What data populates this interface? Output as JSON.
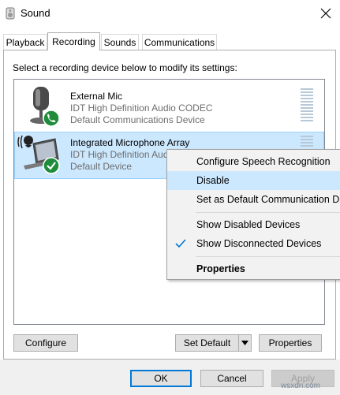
{
  "window": {
    "title": "Sound"
  },
  "tabs": [
    {
      "label": "Playback",
      "active": false
    },
    {
      "label": "Recording",
      "active": true
    },
    {
      "label": "Sounds",
      "active": false
    },
    {
      "label": "Communications",
      "active": false
    }
  ],
  "instruction": "Select a recording device below to modify its settings:",
  "devices": [
    {
      "name": "External Mic",
      "driver": "IDT High Definition Audio CODEC",
      "status": "Default Communications Device",
      "icon": "microphone-icon",
      "badge": "phone-badge-icon"
    },
    {
      "name": "Integrated Microphone Array",
      "driver": "IDT High Definition Audio",
      "status": "Default Device",
      "icon": "laptop-microphone-icon",
      "badge": "checkmark-badge-icon",
      "selected": true
    }
  ],
  "context_menu": {
    "items": [
      {
        "label": "Configure Speech Recognition",
        "bold": false
      },
      {
        "label": "Disable",
        "hover": true
      },
      {
        "label": "Set as Default Communication Device"
      },
      {
        "label": "Show Disabled Devices"
      },
      {
        "label": "Show Disconnected Devices",
        "checked": true
      },
      {
        "label": "Properties",
        "bold": true
      }
    ]
  },
  "buttons": {
    "configure": "Configure",
    "set_default": "Set Default",
    "properties": "Properties",
    "ok": "OK",
    "cancel": "Cancel",
    "apply": "Apply"
  },
  "watermark": "wsxdn.com",
  "colors": {
    "selection": "#cce8ff",
    "badge_green": "#1e8c3a",
    "accent": "#0078d7"
  }
}
